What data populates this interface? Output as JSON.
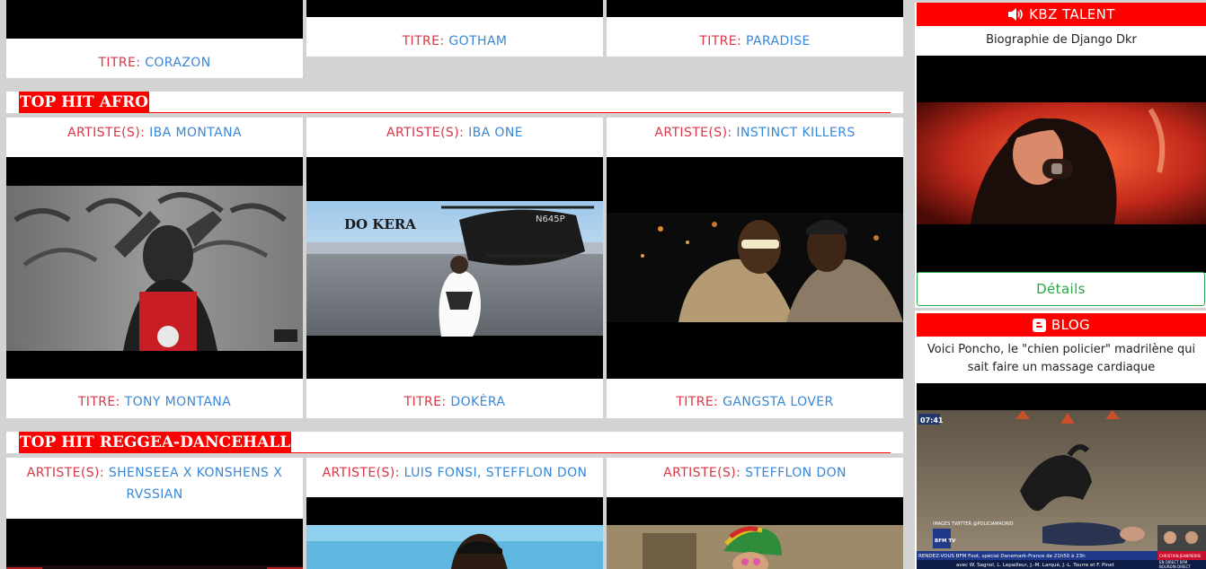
{
  "top_row": [
    {
      "title_label": "TITRE:",
      "title": "CORAZON"
    },
    {
      "title_label": "TITRE:",
      "title": "GOTHAM"
    },
    {
      "title_label": "TITRE:",
      "title": "PARADISE"
    }
  ],
  "section_afro": {
    "heading": "TOP HIT AFRO",
    "cards": [
      {
        "artist_label": "ARTISTE(S):",
        "artist": "IBA MONTANA",
        "title_label": "TITRE:",
        "title": "TONY MONTANA"
      },
      {
        "artist_label": "ARTISTE(S):",
        "artist": "IBA ONE",
        "title_label": "TITRE:",
        "title": "DOKÈRA",
        "overlay_text": "DO KERA",
        "heli_text": "N645P"
      },
      {
        "artist_label": "ARTISTE(S):",
        "artist": "INSTINCT KILLERS",
        "title_label": "TITRE:",
        "title": "GANGSTA LOVER"
      }
    ]
  },
  "section_reggae": {
    "heading": "TOP HIT REGGEA-DANCEHALL",
    "cards": [
      {
        "artist_label": "ARTISTE(S):",
        "artist_line1": "SHENSEEA X KONSHENS X",
        "artist_line2": "RVSSIAN"
      },
      {
        "artist_label": "ARTISTE(S):",
        "artist": "LUIS FONSI, STEFFLON DON"
      },
      {
        "artist_label": "ARTISTE(S):",
        "artist": "STEFFLON DON"
      }
    ]
  },
  "sidebar": {
    "talent": {
      "heading": "KBZ TALENT",
      "icon": "speaker-icon",
      "title": "Biographie de Django Dkr",
      "button": "Détails"
    },
    "blog": {
      "heading": "BLOG",
      "icon": "blogger-icon",
      "title": "Voici Poncho, le \"chien policier\" madrilène qui sait faire un massage cardiaque",
      "tv": {
        "time": "07:41",
        "credit": "IMAGES TWITTER @POLICIAMADRID",
        "channel": "BFM TV",
        "ticker_top": "RENDEZ-VOUS  BFM Foot, spécial Danemark-France de 21h50 à 23h",
        "ticker_bottom": "avec W. Sagnol, L. Lepailleur, J.-M. Larqué, J.-L. Tourre et F. Pinet",
        "side_top": "CHRISTIAN JEANPIERRE",
        "side_bottom": "EN DIRECT BFM",
        "side_tag": "BOURDIN DIRECT"
      }
    }
  },
  "colors": {
    "accent_red": "#ff0000",
    "label_red": "#dc3545",
    "link_blue": "#3a87d6",
    "button_green": "#28a745",
    "page_bg": "#d3d3d3"
  }
}
